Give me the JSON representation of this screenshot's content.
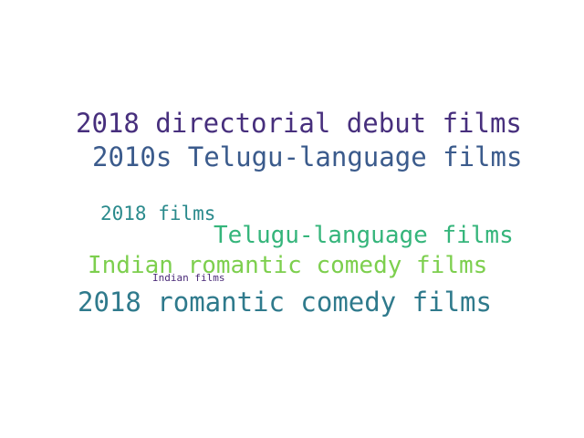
{
  "words": [
    {
      "text": "2018 directorial debut films",
      "color": "#472f7d"
    },
    {
      "text": "2010s Telugu-language films",
      "color": "#3b5b8c"
    },
    {
      "text": "2018 films",
      "color": "#2a8a8c"
    },
    {
      "text": "Telugu-language films",
      "color": "#35b57b"
    },
    {
      "text": "Indian romantic comedy films",
      "color": "#7dcf4e"
    },
    {
      "text": "Indian films",
      "color": "#4a2a78"
    },
    {
      "text": "2018 romantic comedy films",
      "color": "#2f7a8c"
    }
  ]
}
